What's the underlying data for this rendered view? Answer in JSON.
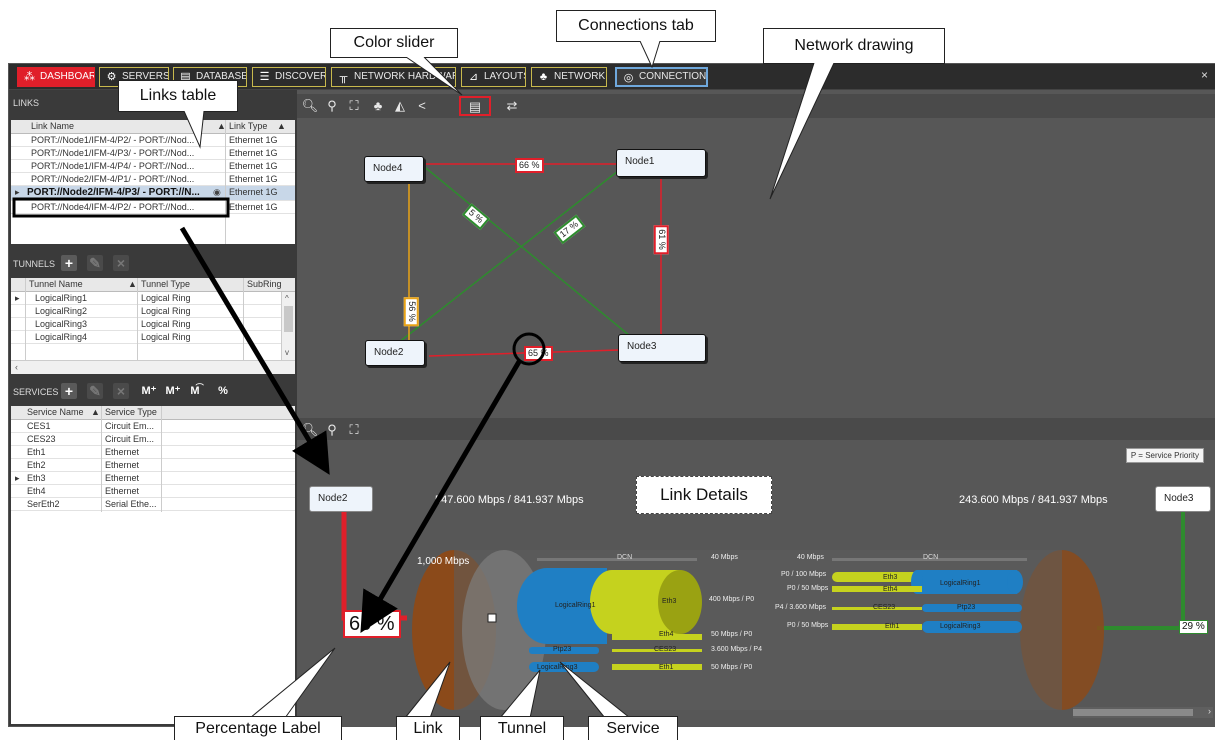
{
  "nav": {
    "items": [
      {
        "label": "DASHBOARD",
        "icon": "dashboard-icon"
      },
      {
        "label": "SERVERS",
        "icon": "gear-icon"
      },
      {
        "label": "DATABASE",
        "icon": "database-icon"
      },
      {
        "label": "DISCOVERY",
        "icon": "list-icon"
      },
      {
        "label": "NETWORK HARDWARE",
        "icon": "hardware-icon"
      },
      {
        "label": "LAYOUTS",
        "icon": "layout-icon"
      },
      {
        "label": "NETWORK",
        "icon": "network-icon"
      },
      {
        "label": "CONNECTIONS",
        "icon": "connections-icon"
      }
    ],
    "close": "×"
  },
  "links": {
    "title": "LINKS",
    "col_name": "Link Name",
    "col_type": "Link Type",
    "rows": [
      {
        "name": "PORT://Node1/IFM-4/P2/ - PORT://Nod...",
        "type": "Ethernet 1G"
      },
      {
        "name": "PORT://Node1/IFM-4/P3/ - PORT://Nod...",
        "type": "Ethernet 1G"
      },
      {
        "name": "PORT://Node1/IFM-4/P4/ - PORT://Nod...",
        "type": "Ethernet 1G"
      },
      {
        "name": "PORT://Node2/IFM-4/P1/ - PORT://Nod...",
        "type": "Ethernet 1G"
      },
      {
        "name": "PORT://Node2/IFM-4/P3/ - PORT://N...",
        "type": "Ethernet 1G"
      },
      {
        "name": "PORT://Node4/IFM-4/P2/ - PORT://Nod...",
        "type": "Ethernet 1G"
      }
    ]
  },
  "tunnels": {
    "title": "TUNNELS",
    "col_name": "Tunnel Name",
    "col_type": "Tunnel Type",
    "col_sub": "SubRing",
    "rows": [
      {
        "name": "LogicalRing1",
        "type": "Logical Ring"
      },
      {
        "name": "LogicalRing2",
        "type": "Logical Ring"
      },
      {
        "name": "LogicalRing3",
        "type": "Logical Ring"
      },
      {
        "name": "LogicalRing4",
        "type": "Logical Ring"
      }
    ]
  },
  "services": {
    "title": "SERVICES",
    "col_name": "Service Name",
    "col_type": "Service Type",
    "rows": [
      {
        "name": "CES1",
        "type": "Circuit Em..."
      },
      {
        "name": "CES23",
        "type": "Circuit Em..."
      },
      {
        "name": "Eth1",
        "type": "Ethernet"
      },
      {
        "name": "Eth2",
        "type": "Ethernet"
      },
      {
        "name": "Eth3",
        "type": "Ethernet"
      },
      {
        "name": "Eth4",
        "type": "Ethernet"
      },
      {
        "name": "SerEth2",
        "type": "Serial Ethe..."
      }
    ]
  },
  "network": {
    "nodes": {
      "node1": "Node1",
      "node2": "Node2",
      "node3": "Node3",
      "node4": "Node4"
    },
    "labels": {
      "n4_n1": "66 %",
      "n4_n3": "5 %",
      "n2_n1": "17 %",
      "n1_n3": "61 %",
      "n4_n2": "56 %",
      "n2_n3": "65 %"
    }
  },
  "details": {
    "priority_btn": "P = Service Priority",
    "left_node": "Node2",
    "right_node": "Node3",
    "left_bw": "547.600 Mbps / 841.937 Mbps",
    "right_bw": "243.600 Mbps / 841.937 Mbps",
    "capacity": "1,000 Mbps",
    "left_pct": "65 %",
    "right_pct": "29 %",
    "left_services": [
      {
        "tunnel": "",
        "service": "DCN",
        "rate": "40 Mbps"
      },
      {
        "tunnel": "LogicalRing1",
        "service": "Eth3",
        "rate": "400 Mbps / P0"
      },
      {
        "tunnel": "",
        "service": "Eth4",
        "rate": "50 Mbps / P0"
      },
      {
        "tunnel": "Ptp23",
        "service": "CES23",
        "rate": "3.600 Mbps / P4"
      },
      {
        "tunnel": "LogicalRing3",
        "service": "Eth1",
        "rate": "50 Mbps / P0"
      }
    ],
    "right_rows": [
      {
        "rate": "40 Mbps",
        "service": "DCN",
        "tunnel": ""
      },
      {
        "rate": "P0 / 100 Mbps",
        "service": "Eth3",
        "tunnel": "LogicalRing1"
      },
      {
        "rate": "P0 / 50 Mbps",
        "service": "Eth4",
        "tunnel": ""
      },
      {
        "rate": "P4 / 3.600 Mbps",
        "service": "CES23",
        "tunnel": "Ptp23"
      },
      {
        "rate": "P0 / 50 Mbps",
        "service": "Eth1",
        "tunnel": "LogicalRing3"
      }
    ]
  },
  "callouts": {
    "color_slider": "Color slider",
    "connections_tab": "Connections tab",
    "network_drawing": "Network drawing",
    "links_table": "Links table",
    "link_details": "Link Details",
    "percentage_label": "Percentage Label",
    "link": "Link",
    "tunnel": "Tunnel",
    "service": "Service"
  },
  "colors": {
    "red": "#e01f2a",
    "green": "#2e8b2e",
    "orange": "#e8a317",
    "link_brown": "#8b4a1a",
    "tunnel_blue": "#1f7fc4",
    "service_yellow": "#c5d21e"
  }
}
